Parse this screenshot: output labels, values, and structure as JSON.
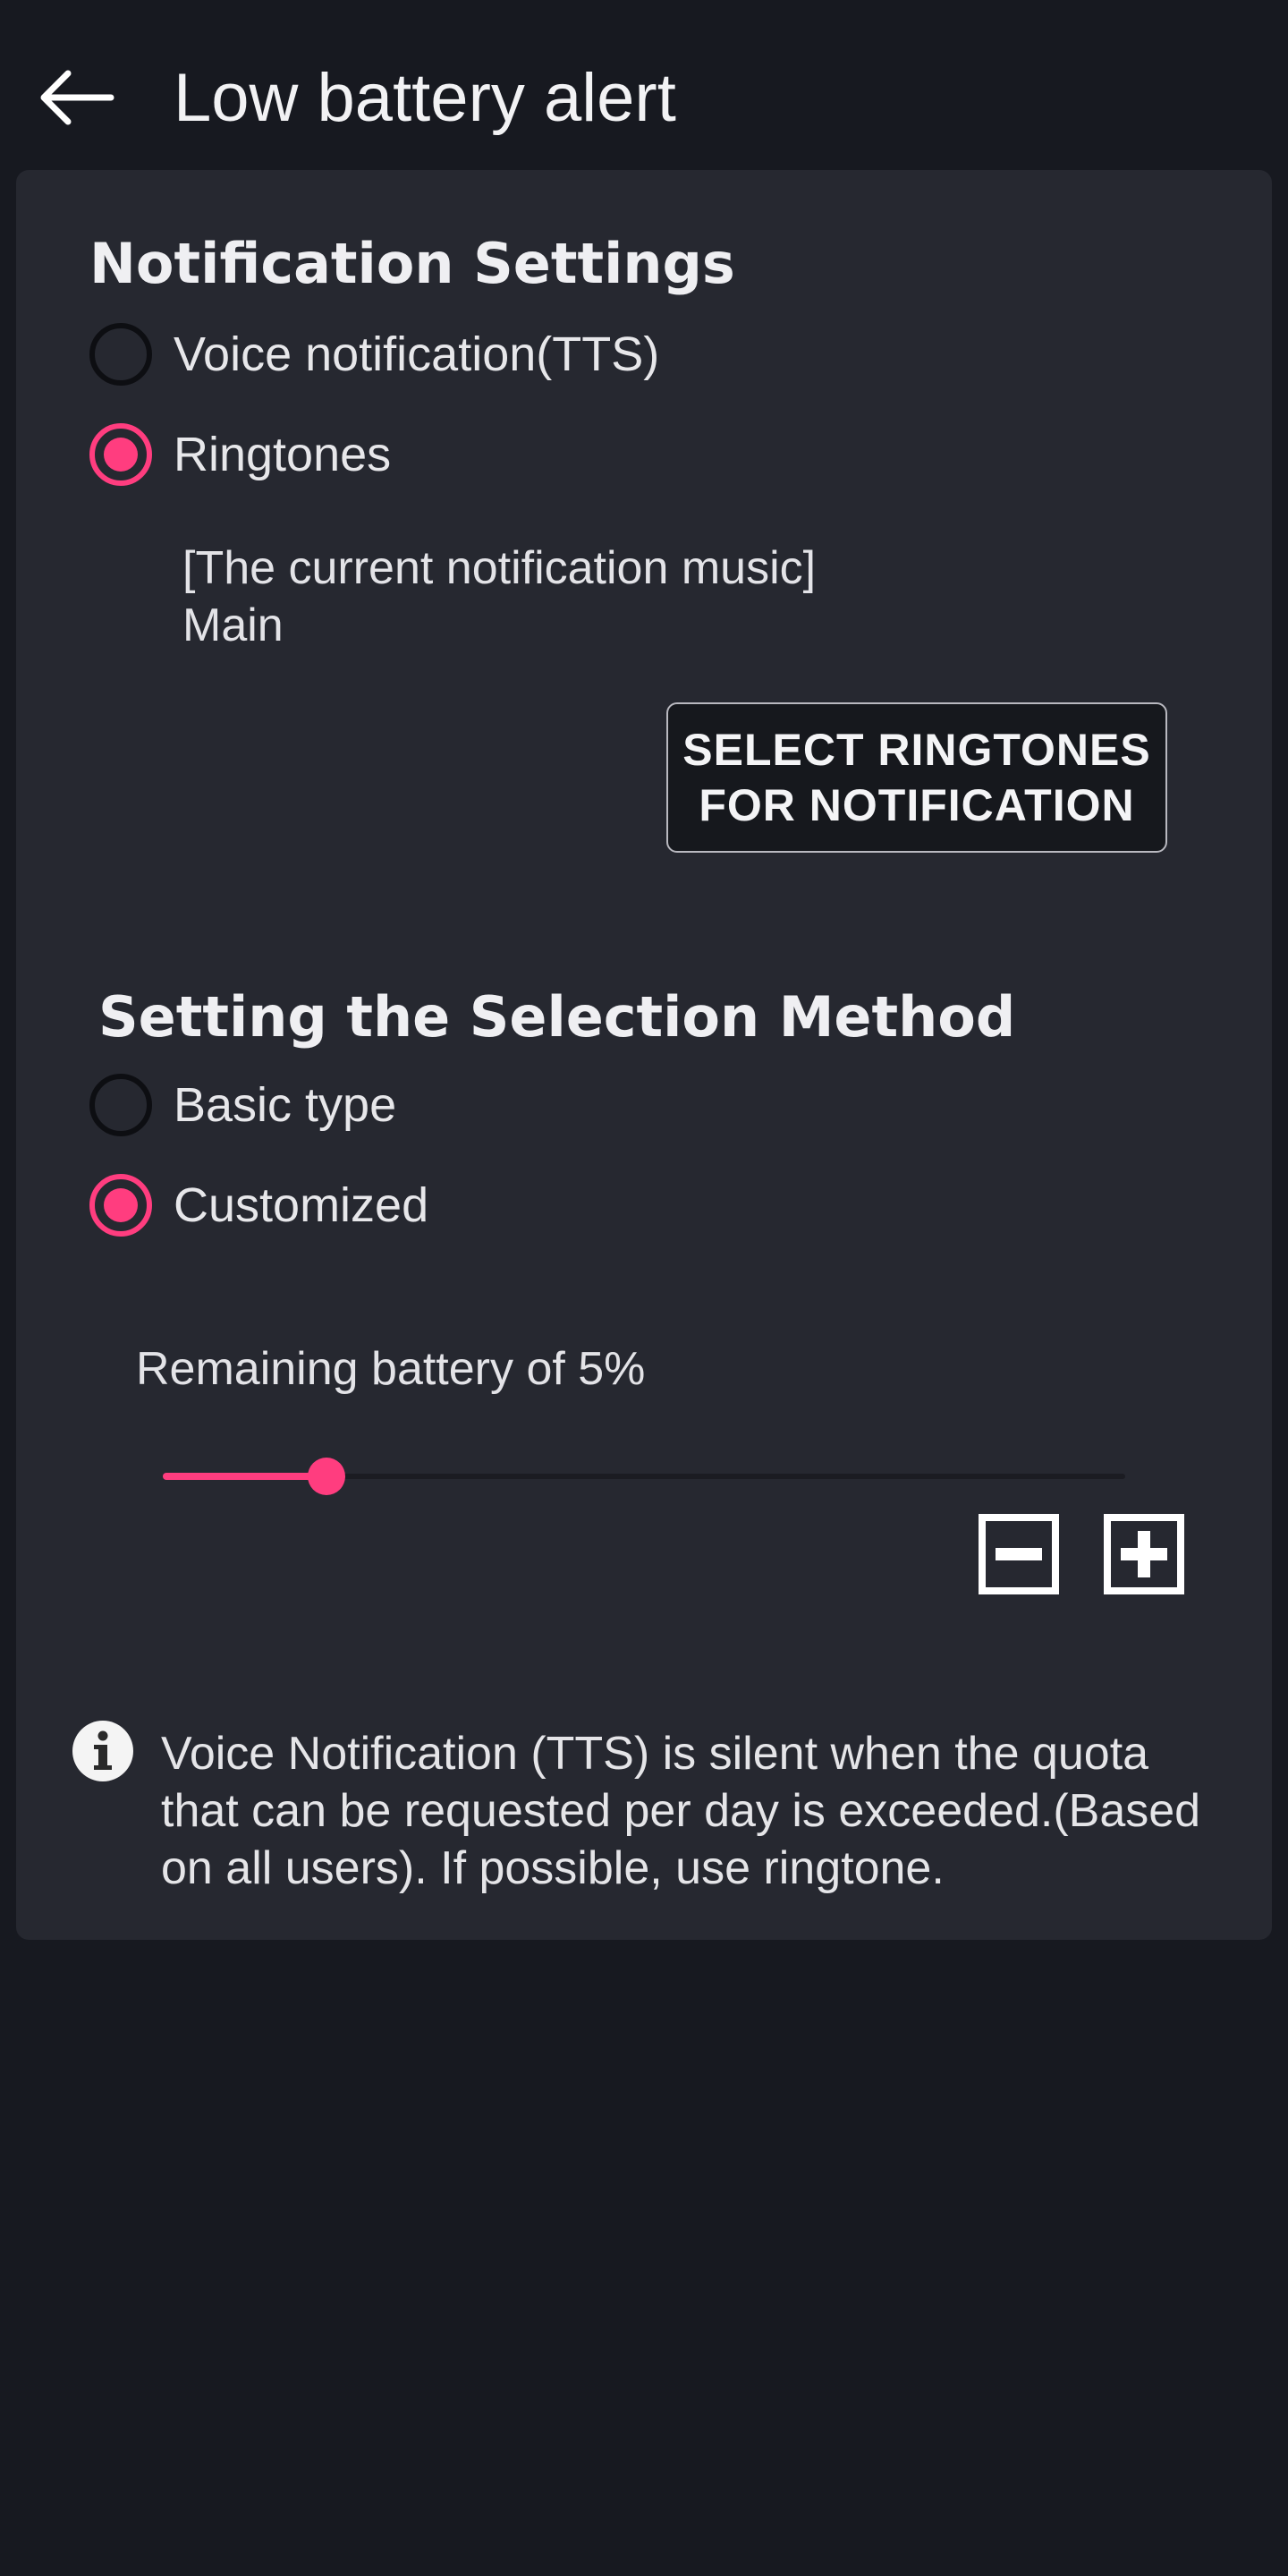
{
  "app_bar": {
    "title": "Low battery alert",
    "back_icon": "arrow-left-icon"
  },
  "notification_settings": {
    "title": "Notification Settings",
    "options": [
      {
        "label": "Voice notification(TTS)",
        "selected": false
      },
      {
        "label": "Ringtones",
        "selected": true
      }
    ],
    "current_music_label": "[The current notification music]",
    "current_music_value": "Main",
    "select_button_line1": "SELECT RINGTONES",
    "select_button_line2": "FOR NOTIFICATION"
  },
  "selection_method": {
    "title": "Setting the Selection Method",
    "options": [
      {
        "label": "Basic type",
        "selected": false
      },
      {
        "label": "Customized",
        "selected": true
      }
    ],
    "slider_label": "Remaining battery of 5%",
    "slider_fraction": 0.17,
    "minus_icon": "minus-box-icon",
    "plus_icon": "plus-box-icon"
  },
  "note": {
    "icon": "info-icon",
    "lines": [
      "Voice Notification (TTS) is silent when the quota",
      "that can be requested per day is exceeded.(Based",
      "on all users). If possible, use ringtone."
    ]
  },
  "colors": {
    "background": "#171920",
    "card": "#262830",
    "accent": "#ff3d7f",
    "text": "#e9e9ec"
  }
}
